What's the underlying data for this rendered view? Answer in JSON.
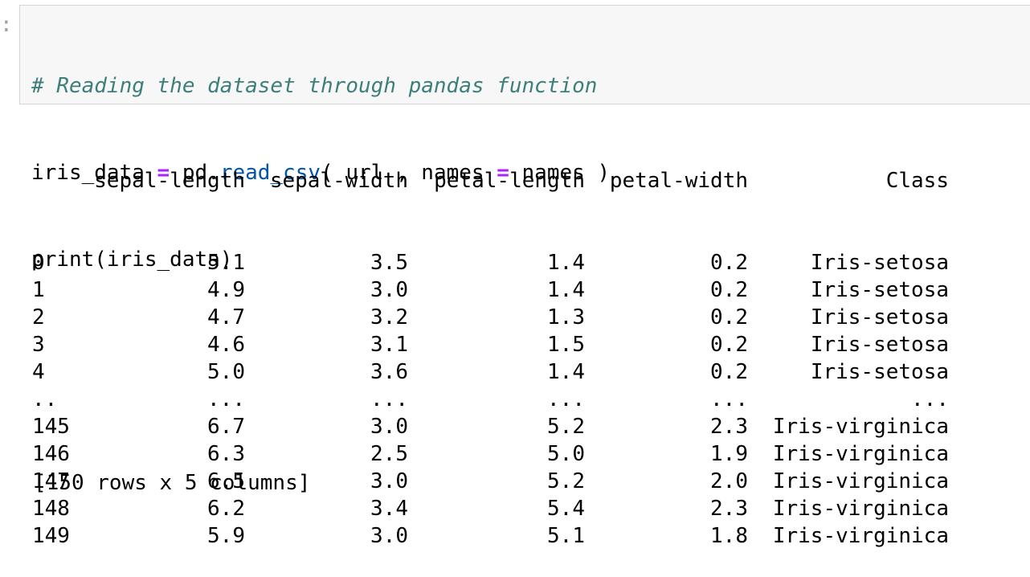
{
  "prompt_marker": ":",
  "code": {
    "comment": "# Reading the dataset through pandas function",
    "line2": {
      "var": "iris_data",
      "eq1": "=",
      "obj": "pd.",
      "func": "read_csv",
      "args_open": "( url , names ",
      "eq2": "=",
      "args_close": " names )"
    },
    "line3": "print(iris_data)"
  },
  "output": {
    "columns": [
      "sepal-length",
      "sepal-width",
      "petal-length",
      "petal-width",
      "Class"
    ],
    "rows": [
      {
        "idx": "0",
        "v1": "5.1",
        "v2": "3.5",
        "v3": "1.4",
        "v4": "0.2",
        "v5": "Iris-setosa"
      },
      {
        "idx": "1",
        "v1": "4.9",
        "v2": "3.0",
        "v3": "1.4",
        "v4": "0.2",
        "v5": "Iris-setosa"
      },
      {
        "idx": "2",
        "v1": "4.7",
        "v2": "3.2",
        "v3": "1.3",
        "v4": "0.2",
        "v5": "Iris-setosa"
      },
      {
        "idx": "3",
        "v1": "4.6",
        "v2": "3.1",
        "v3": "1.5",
        "v4": "0.2",
        "v5": "Iris-setosa"
      },
      {
        "idx": "4",
        "v1": "5.0",
        "v2": "3.6",
        "v3": "1.4",
        "v4": "0.2",
        "v5": "Iris-setosa"
      },
      {
        "idx": "..",
        "v1": "...",
        "v2": "...",
        "v3": "...",
        "v4": "...",
        "v5": "..."
      },
      {
        "idx": "145",
        "v1": "6.7",
        "v2": "3.0",
        "v3": "5.2",
        "v4": "2.3",
        "v5": "Iris-virginica"
      },
      {
        "idx": "146",
        "v1": "6.3",
        "v2": "2.5",
        "v3": "5.0",
        "v4": "1.9",
        "v5": "Iris-virginica"
      },
      {
        "idx": "147",
        "v1": "6.5",
        "v2": "3.0",
        "v3": "5.2",
        "v4": "2.0",
        "v5": "Iris-virginica"
      },
      {
        "idx": "148",
        "v1": "6.2",
        "v2": "3.4",
        "v3": "5.4",
        "v4": "2.3",
        "v5": "Iris-virginica"
      },
      {
        "idx": "149",
        "v1": "5.9",
        "v2": "3.0",
        "v3": "5.1",
        "v4": "1.8",
        "v5": "Iris-virginica"
      }
    ],
    "summary": "[150 rows x 5 columns]"
  }
}
